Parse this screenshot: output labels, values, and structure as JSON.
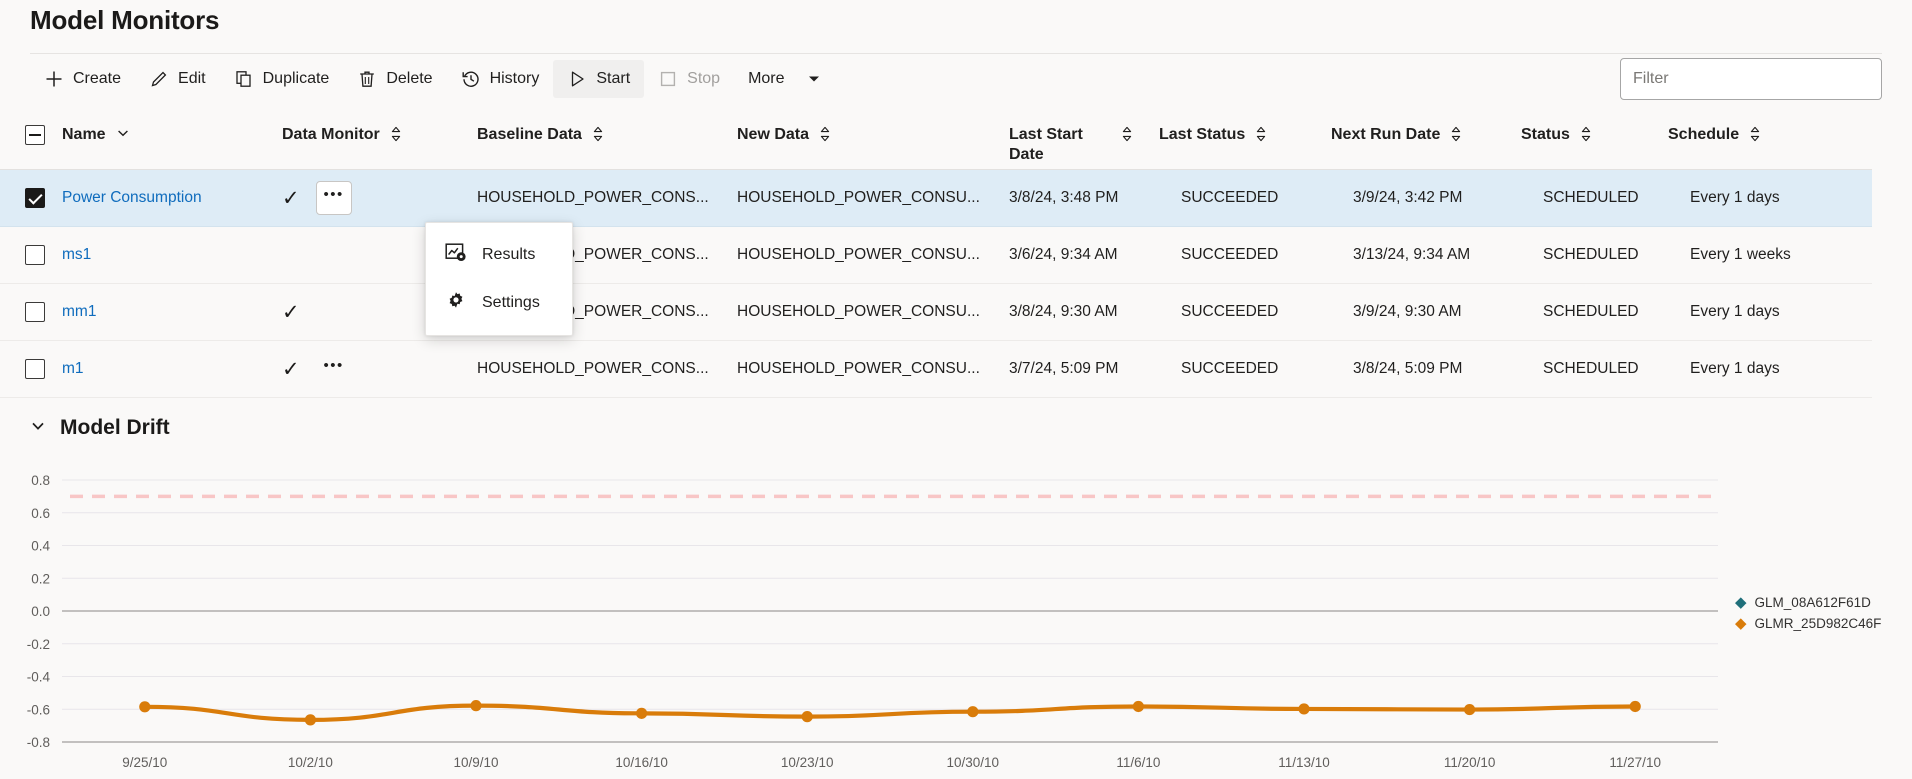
{
  "page": {
    "title": "Model Monitors"
  },
  "toolbar": {
    "items": [
      {
        "label": "Create",
        "icon": "plus-icon",
        "state": "normal"
      },
      {
        "label": "Edit",
        "icon": "pencil-icon",
        "state": "normal"
      },
      {
        "label": "Duplicate",
        "icon": "copy-icon",
        "state": "normal"
      },
      {
        "label": "Delete",
        "icon": "trash-icon",
        "state": "normal"
      },
      {
        "label": "History",
        "icon": "history-icon",
        "state": "normal"
      },
      {
        "label": "Start",
        "icon": "play-icon",
        "state": "hovered"
      },
      {
        "label": "Stop",
        "icon": "stop-square-icon",
        "state": "disabled"
      },
      {
        "label": "More",
        "icon": "chevron-down-icon",
        "state": "normal"
      }
    ]
  },
  "search": {
    "placeholder": "Filter",
    "value": ""
  },
  "table": {
    "columns": [
      {
        "key": "select",
        "label": "",
        "sort": "none"
      },
      {
        "key": "name",
        "label": "Name",
        "sort": "chevron"
      },
      {
        "key": "data_mon",
        "label": "Data Monitor",
        "sort": "both"
      },
      {
        "key": "baseline",
        "label": "Baseline Data",
        "sort": "both"
      },
      {
        "key": "newdata",
        "label": "New Data",
        "sort": "both"
      },
      {
        "key": "laststart",
        "label": "Last Start Date",
        "sort": "both"
      },
      {
        "key": "laststatus",
        "label": "Last Status",
        "sort": "both"
      },
      {
        "key": "nextrun",
        "label": "Next Run Date",
        "sort": "both"
      },
      {
        "key": "status",
        "label": "Status",
        "sort": "both"
      },
      {
        "key": "schedule",
        "label": "Schedule",
        "sort": "both"
      }
    ],
    "header_select_state": "indeterminate",
    "rows": [
      {
        "selected": true,
        "name": "Power Consumption",
        "data_monitor": true,
        "menu_open": true,
        "baseline": "HOUSEHOLD_POWER_CONS...",
        "newdata": "HOUSEHOLD_POWER_CONSU...",
        "laststart": "3/8/24, 3:48 PM",
        "laststatus": "SUCCEEDED",
        "nextrun": "3/9/24, 3:42 PM",
        "status": "SCHEDULED",
        "schedule": "Every 1 days"
      },
      {
        "selected": false,
        "name": "ms1",
        "data_monitor": false,
        "menu_open": false,
        "baseline": "HOUSEHOLD_POWER_CONS...",
        "newdata": "HOUSEHOLD_POWER_CONSU...",
        "laststart": "3/6/24, 9:34 AM",
        "laststatus": "SUCCEEDED",
        "nextrun": "3/13/24, 9:34 AM",
        "status": "SCHEDULED",
        "schedule": "Every 1 weeks"
      },
      {
        "selected": false,
        "name": "mm1",
        "data_monitor": true,
        "menu_open": false,
        "baseline": "HOUSEHOLD_POWER_CONS...",
        "newdata": "HOUSEHOLD_POWER_CONSU...",
        "laststart": "3/8/24, 9:30 AM",
        "laststatus": "SUCCEEDED",
        "nextrun": "3/9/24, 9:30 AM",
        "status": "SCHEDULED",
        "schedule": "Every 1 days"
      },
      {
        "selected": false,
        "name": "m1",
        "data_monitor": true,
        "menu_open": false,
        "baseline": "HOUSEHOLD_POWER_CONS...",
        "newdata": "HOUSEHOLD_POWER_CONSU...",
        "laststart": "3/7/24, 5:09 PM",
        "laststatus": "SUCCEEDED",
        "nextrun": "3/8/24, 5:09 PM",
        "status": "SCHEDULED",
        "schedule": "Every 1 days"
      }
    ]
  },
  "context_menu": {
    "items": [
      {
        "label": "Results",
        "icon": "chart-settings-icon"
      },
      {
        "label": "Settings",
        "icon": "gear-icon"
      }
    ]
  },
  "section": {
    "title": "Model Drift",
    "expanded": true
  },
  "chart_data": {
    "type": "line",
    "title": "Model Drift",
    "xlabel": "",
    "ylabel": "",
    "grid": true,
    "legend_position": "right",
    "ylim": [
      -0.8,
      0.8
    ],
    "yticks": [
      "0.8",
      "0.6",
      "0.4",
      "0.2",
      "0.0",
      "-0.2",
      "-0.4",
      "-0.6",
      "-0.8"
    ],
    "ytick_values": [
      0.8,
      0.6,
      0.4,
      0.2,
      0.0,
      -0.2,
      -0.4,
      -0.6,
      -0.8
    ],
    "xticks": [
      "9/25/10",
      "10/2/10",
      "10/9/10",
      "10/16/10",
      "10/23/10",
      "10/30/10",
      "11/6/10",
      "11/13/10",
      "11/20/10",
      "11/27/10"
    ],
    "threshold": {
      "value": 0.7,
      "color": "#f8c6c6",
      "style": "dashed"
    },
    "series": [
      {
        "name": "GLM_08A612F61D",
        "color": "#1f6f7a",
        "marker": "diamond",
        "values": []
      },
      {
        "name": "GLMR_25D982C46F",
        "color": "#d97c0a",
        "marker": "diamond",
        "x": [
          "9/25/10",
          "10/2/10",
          "10/9/10",
          "10/16/10",
          "10/23/10",
          "10/30/10",
          "11/6/10",
          "11/13/10",
          "11/20/10",
          "11/27/10"
        ],
        "values": [
          -0.585,
          -0.665,
          -0.578,
          -0.625,
          -0.645,
          -0.615,
          -0.583,
          -0.598,
          -0.602,
          -0.583
        ]
      }
    ]
  },
  "colors": {
    "accent_link": "#0f6cbd",
    "row_selected": "#deecf6",
    "series_orange": "#d97c0a",
    "series_teal": "#1f6f7a",
    "threshold_pink": "#f8c6c6",
    "page_bg": "#faf9f8"
  }
}
